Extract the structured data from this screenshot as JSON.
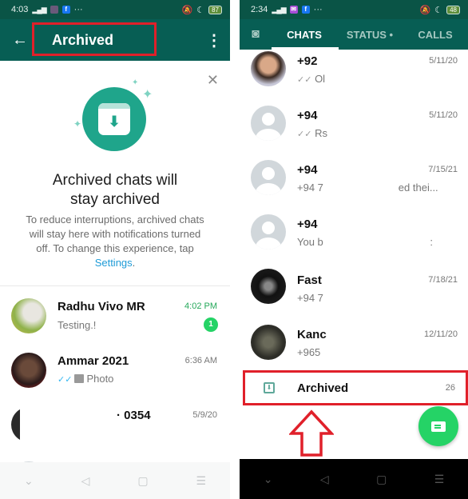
{
  "left": {
    "status": {
      "time": "4:03",
      "battery": "87"
    },
    "appbar": {
      "back_icon": "←",
      "title": "Archived",
      "menu_icon": "⋮"
    },
    "banner": {
      "close_icon": "✕",
      "title_line1": "Archived chats will",
      "title_line2": "stay archived",
      "text": "To reduce interruptions, archived chats will stay here with notifications turned off. To change this experience, tap ",
      "link": "Settings",
      "text_end": "."
    },
    "chats": [
      {
        "name": "Radhu Vivo MR",
        "message": "Testing.!",
        "time": "4:02 PM",
        "unread": "1"
      },
      {
        "name": "Ammar 2021",
        "ticks": "✓✓",
        "message": "Photo",
        "time": "6:36 AM"
      },
      {
        "name": "· 0354",
        "message": "",
        "time": "5/9/20"
      }
    ],
    "nav": {
      "down": "⌄",
      "back": "◁",
      "home": "▢",
      "menu": "☰"
    }
  },
  "right": {
    "status": {
      "time": "2:34",
      "battery": "48"
    },
    "tabs": {
      "camera_icon": "📷",
      "chats": "CHATS",
      "status": "STATUS •",
      "calls": "CALLS"
    },
    "chats": [
      {
        "name": "+92",
        "ticks": "✓✓",
        "message": "Ol",
        "time": "5/11/20"
      },
      {
        "name": "+94",
        "ticks": "✓✓",
        "message": "Rs",
        "time": "5/11/20"
      },
      {
        "name": "+94",
        "message": "+94 7                          ed thei...",
        "time": "7/15/21"
      },
      {
        "name": "+94",
        "message": "You b                                     :",
        "time": ""
      },
      {
        "name": "Fast",
        "message": "+94 7",
        "time": "7/18/21"
      },
      {
        "name": "Kanc",
        "message": "+965",
        "time": "12/11/20"
      }
    ],
    "archived": {
      "label": "Archived",
      "count": "26"
    },
    "nav": {
      "down": "⌄",
      "back": "◁",
      "home": "▢",
      "menu": "☰"
    }
  },
  "colors": {
    "primary": "#075e54",
    "accent": "#25d366",
    "highlight": "#e0202a"
  }
}
